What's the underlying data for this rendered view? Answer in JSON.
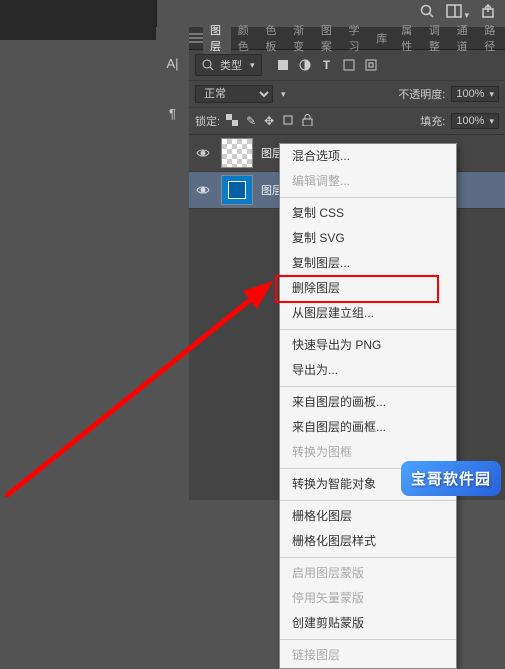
{
  "panel": {
    "tabs": [
      "图层",
      "颜色",
      "色板",
      "渐变",
      "图案",
      "学习",
      "库",
      "属性",
      "调整",
      "通道",
      "路径"
    ],
    "active_tab": "图层",
    "type_label": "类型",
    "blend_mode": "正常",
    "opacity_label": "不透明度:",
    "opacity_value": "100%",
    "lock_label": "锁定:",
    "fill_label": "填充:",
    "fill_value": "100%"
  },
  "layers": {
    "item0": "图层",
    "item1": "图层"
  },
  "menu": {
    "blend_options": "混合选项...",
    "edit_adjust": "编辑调整...",
    "copy_css": "复制 CSS",
    "copy_svg": "复制 SVG",
    "dup_layer": "复制图层...",
    "del_layer": "删除图层",
    "group_from_layers": "从图层建立组...",
    "quick_export": "快速导出为 PNG",
    "export_as": "导出为...",
    "artboard_from_layers": "来自图层的画板...",
    "frame_from_layers": "来自图层的画框...",
    "convert_to_frame": "转换为图框",
    "convert_smart": "转换为智能对象",
    "rasterize_layer": "栅格化图层",
    "rasterize_style": "栅格化图层样式",
    "enable_mask": "启用图层蒙版",
    "enable_vmask": "停用矢量蒙版",
    "create_clipping": "创建剪贴蒙版",
    "link_layers": "链接图层"
  },
  "watermark": "宝哥软件园"
}
